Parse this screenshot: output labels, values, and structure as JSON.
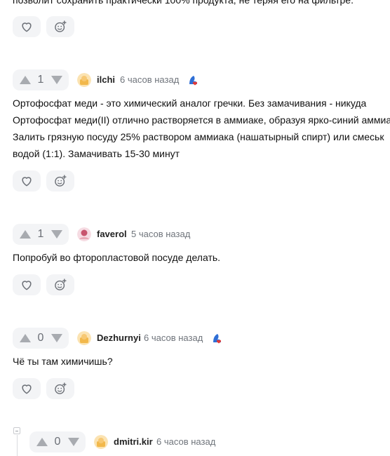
{
  "top_comment": {
    "partial_text": "позволит сохранить практически 100% продукта, не теряя его на фильтре."
  },
  "comments": [
    {
      "score": "1",
      "author": "ilchi",
      "time": "6 часов назад",
      "lines": [
        "Ортофосфат меди - это химический аналог гречки. Без замачивания - никуда",
        "Ортофосфат меди(II) отлично растворяется в аммиаке, образуя ярко-синий аммиа",
        "Залить грязную посуду 25% раствором аммиака (нашатырный спирт) или смеськ",
        "водой (1:1). Замачивать 15-30 минут"
      ]
    },
    {
      "score": "1",
      "author": "faverol",
      "time": "5 часов назад",
      "lines": [
        "Попробуй во фторопластовой посуде делать."
      ]
    },
    {
      "score": "0",
      "author": "Dezhurnyi",
      "time": "6 часов назад",
      "lines": [
        "Чё ты там химичишь?"
      ]
    },
    {
      "score": "0",
      "author": "dmitri.kir",
      "time": "6 часов назад",
      "lines": []
    }
  ],
  "icons": {
    "like": "heart-icon",
    "react": "emoji-add-icon",
    "upvote": "triangle-up-icon",
    "downvote": "triangle-down-icon",
    "badge": "profile-badge-icon",
    "collapse": "collapse-thread-icon"
  },
  "colors": {
    "pill_bg": "#f3f4f6",
    "icon_gray": "#6b6f76",
    "arrow_gray": "#a8abb0",
    "badge_blue": "#2f6fd6",
    "badge_red": "#e53935"
  }
}
